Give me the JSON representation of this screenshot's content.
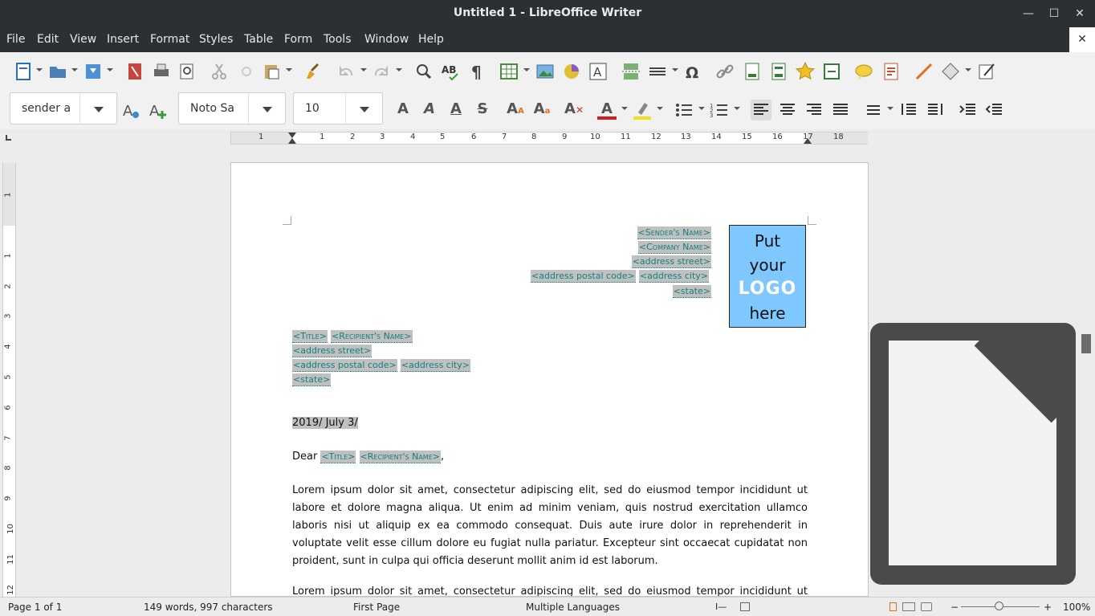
{
  "window": {
    "title": "Untitled 1 - LibreOffice Writer",
    "minimize": "—",
    "maximize": "☐",
    "close": "✕"
  },
  "menu": [
    "File",
    "Edit",
    "View",
    "Insert",
    "Format",
    "Styles",
    "Table",
    "Form",
    "Tools",
    "Window",
    "Help"
  ],
  "menu_close_doc": "✕",
  "toolbar2": {
    "paragraph_style": "sender a",
    "font_name": "Noto Sa",
    "font_size": "10"
  },
  "hruler_numbers": [
    "1",
    "1",
    "2",
    "3",
    "4",
    "5",
    "6",
    "7",
    "8",
    "9",
    "10",
    "11",
    "12",
    "13",
    "14",
    "15",
    "16",
    "17",
    "18"
  ],
  "vruler_numbers": [
    "1",
    "1",
    "2",
    "3",
    "4",
    "5",
    "6",
    "7",
    "8",
    "9",
    "10",
    "11",
    "12"
  ],
  "sender": {
    "name": "<Sender's Name>",
    "company": "<Company Name>",
    "street": "<address street>",
    "postal": "<address postal code>",
    "city": "<address city>",
    "state": "<state>"
  },
  "logo": {
    "line1": "Put",
    "line2": "your",
    "line3": "LOGO",
    "line4": "here"
  },
  "recipient": {
    "title": "<Title>",
    "name": "<Recipient's Name>",
    "street": "<address street>",
    "postal": "<address postal code>",
    "city": "<address city>",
    "state": "<state>"
  },
  "date": "2019/ July 3/",
  "salutation": {
    "dear": "Dear",
    "title": "<Title>",
    "name": "<Recipient's Name>",
    "comma": ","
  },
  "body": [
    "Lorem ipsum dolor sit amet, consectetur adipiscing elit, sed do eiusmod tempor incididunt ut labore et dolore magna aliqua. Ut enim ad minim veniam, quis nostrud exercitation ullamco laboris nisi ut aliquip ex ea commodo consequat. Duis aute irure dolor in reprehenderit in voluptate velit esse cillum dolore eu fugiat nulla pariatur. Excepteur sint occaecat cupidatat non proident, sunt in culpa qui officia deserunt mollit anim id est laborum.",
    "Lorem ipsum dolor sit amet, consectetur adipiscing elit, sed do eiusmod tempor incididunt ut labore et"
  ],
  "status": {
    "page": "Page 1 of 1",
    "words": "149 words, 997 characters",
    "page_style": "First Page",
    "language": "Multiple Languages",
    "zoom": "100%"
  }
}
